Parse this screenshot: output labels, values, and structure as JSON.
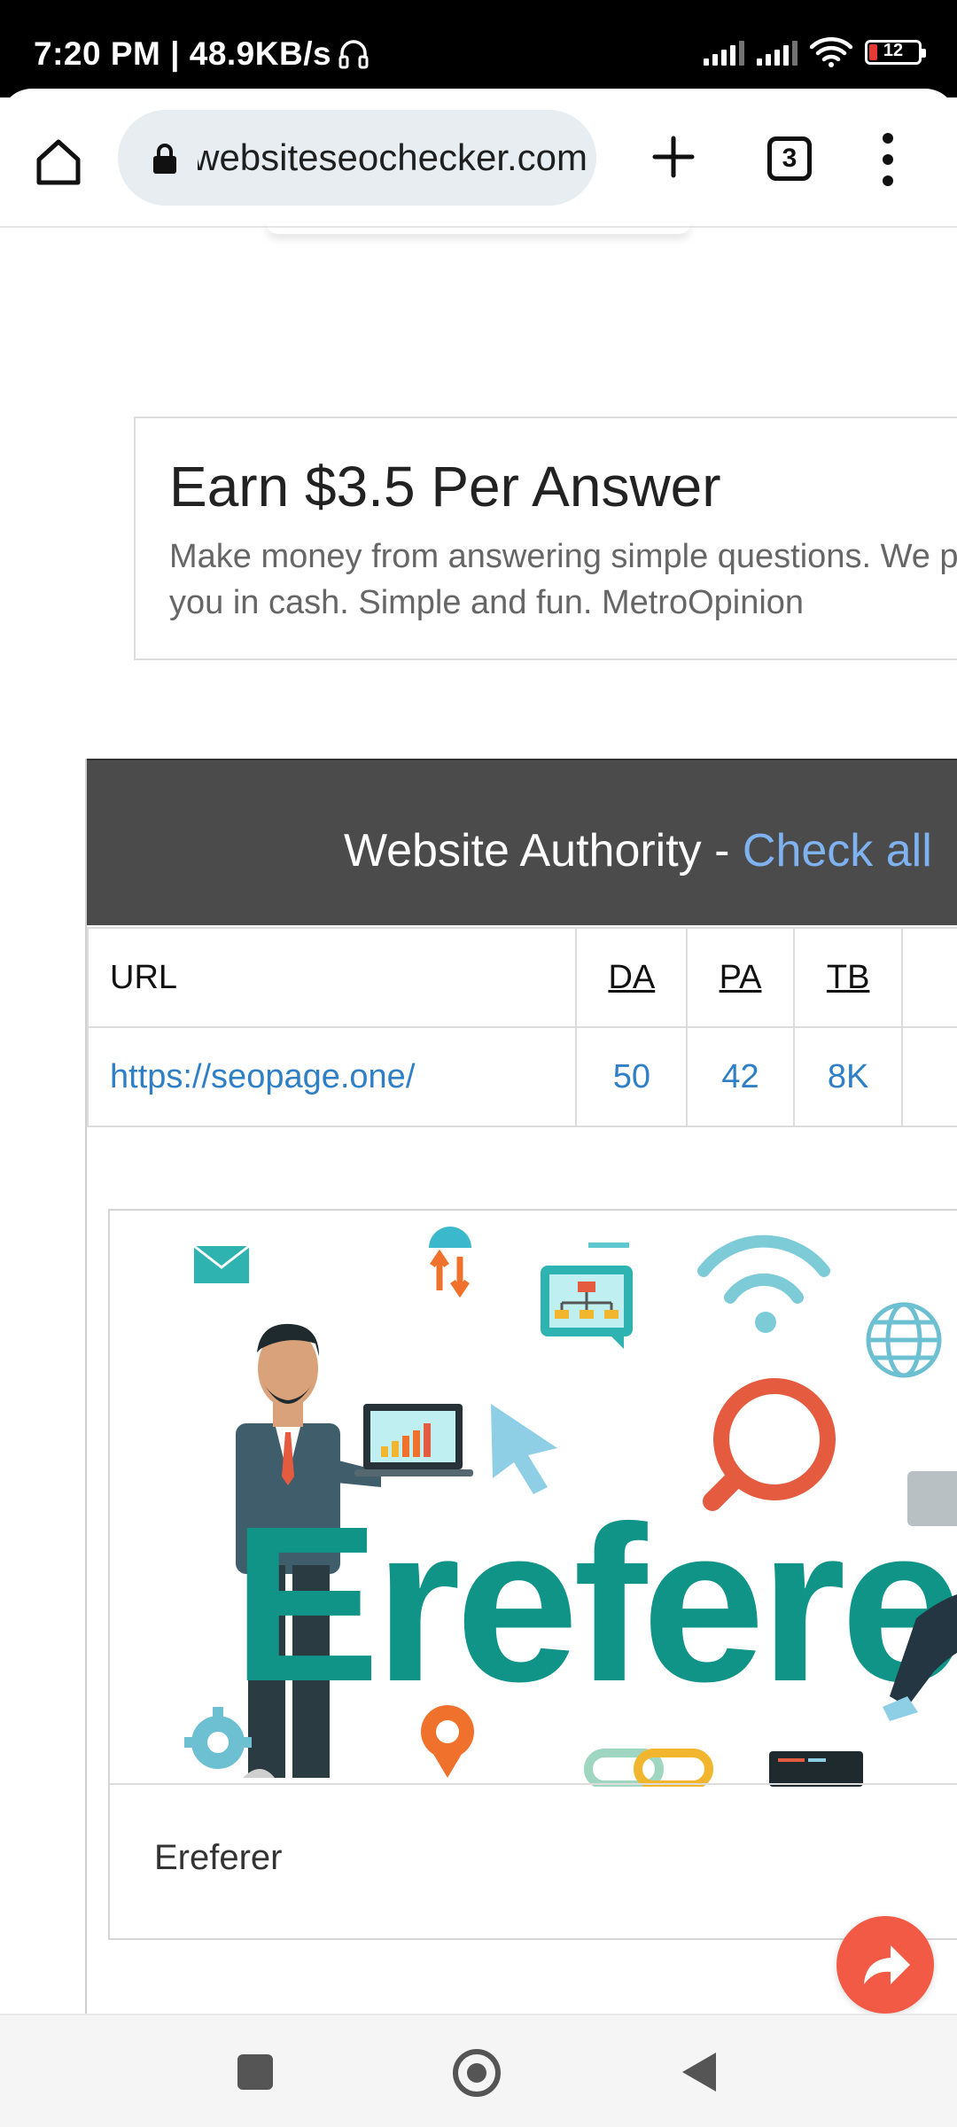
{
  "status_bar": {
    "time_speed": "7:20 PM | 48.9KB/s",
    "battery": "12"
  },
  "browser": {
    "url": "websiteseochecker.com",
    "tab_count": "3"
  },
  "ad": {
    "title": "Earn $3.5 Per Answer",
    "body": "Make money from answering simple questions. We pay you in cash. Simple and fun. MetroOpinion"
  },
  "authority": {
    "heading": "Website Authority - ",
    "heading_link": "Check all",
    "headers": {
      "url": "URL",
      "da": "DA",
      "pa": "PA",
      "tb": "TB"
    },
    "row": {
      "url": "https://seopage.one/",
      "da": "50",
      "pa": "42",
      "tb": "8K"
    }
  },
  "preview": {
    "image_word": "Ereferer",
    "caption": "Ereferer"
  },
  "icons": {
    "home": "home-icon",
    "lock": "lock-icon",
    "new_tab": "plus-icon",
    "menu": "more-vert-icon",
    "share": "share-icon"
  }
}
